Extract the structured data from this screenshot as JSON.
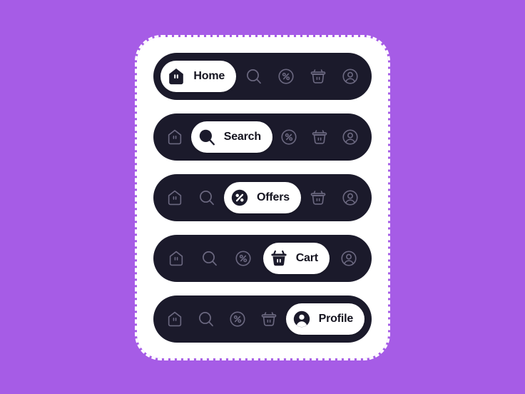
{
  "background_color": "#a65ce6",
  "card": {
    "name": "navigation-bar-showcase",
    "background": "#ffffff",
    "border_style": "dashed"
  },
  "theme": {
    "bar_background": "#1b1a2b",
    "active_pill_background": "#ffffff",
    "active_icon_fill": "#1b1a2b",
    "active_label_color": "#14131f",
    "inactive_icon_color": "#6b6880"
  },
  "items": [
    {
      "id": "home",
      "label": "Home",
      "icon": "home-icon"
    },
    {
      "id": "search",
      "label": "Search",
      "icon": "search-icon"
    },
    {
      "id": "offers",
      "label": "Offers",
      "icon": "percent-icon"
    },
    {
      "id": "cart",
      "label": "Cart",
      "icon": "basket-icon"
    },
    {
      "id": "profile",
      "label": "Profile",
      "icon": "person-icon"
    }
  ],
  "bars": [
    {
      "name": "navbar-home-active",
      "active_index": 0,
      "active_label": "Home"
    },
    {
      "name": "navbar-search-active",
      "active_index": 1,
      "active_label": "Search"
    },
    {
      "name": "navbar-offers-active",
      "active_index": 2,
      "active_label": "Offers"
    },
    {
      "name": "navbar-cart-active",
      "active_index": 3,
      "active_label": "Cart"
    },
    {
      "name": "navbar-profile-active",
      "active_index": 4,
      "active_label": "Profile"
    }
  ]
}
